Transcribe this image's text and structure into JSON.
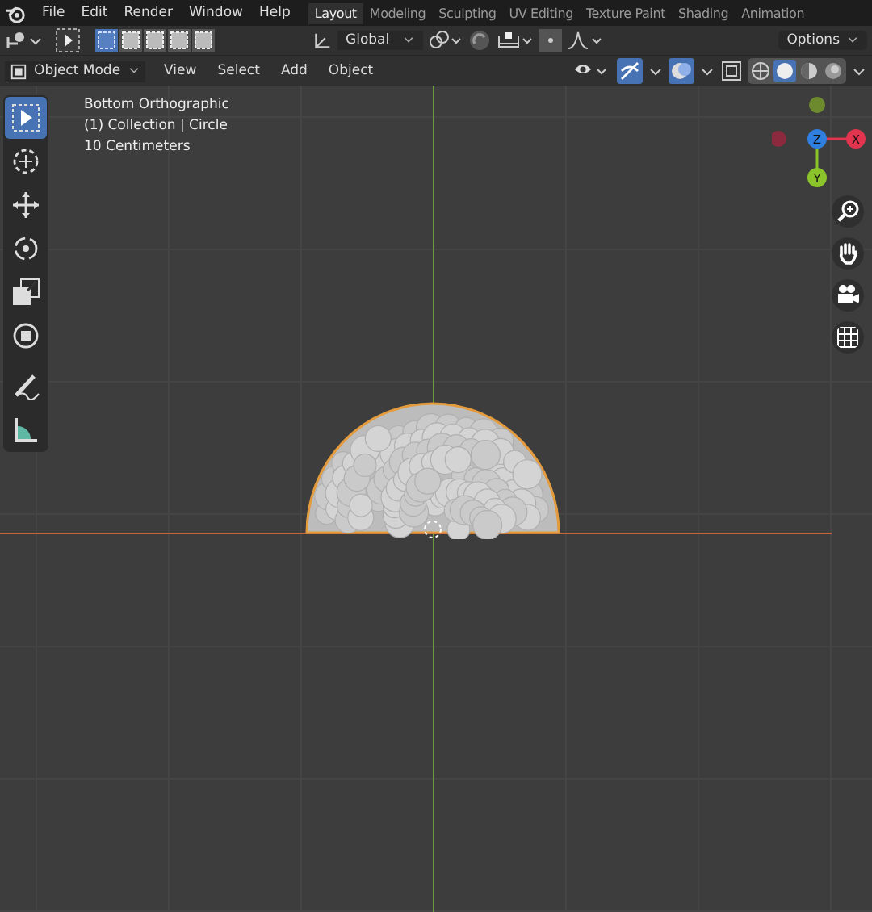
{
  "menu": [
    "File",
    "Edit",
    "Render",
    "Window",
    "Help"
  ],
  "workspaces": [
    {
      "label": "Layout",
      "selected": true
    },
    {
      "label": "Modeling",
      "selected": false
    },
    {
      "label": "Sculpting",
      "selected": false
    },
    {
      "label": "UV Editing",
      "selected": false
    },
    {
      "label": "Texture Paint",
      "selected": false
    },
    {
      "label": "Shading",
      "selected": false
    },
    {
      "label": "Animation",
      "selected": false
    }
  ],
  "tool_header": {
    "select_modes": [
      {
        "selected": true
      },
      {
        "selected": false
      },
      {
        "selected": false
      },
      {
        "selected": false
      },
      {
        "selected": false
      }
    ],
    "orientation": "Global",
    "options": "Options"
  },
  "viewport_header": {
    "mode": "Object Mode",
    "menus": [
      "View",
      "Select",
      "Add",
      "Object"
    ],
    "shading": [
      {
        "kind": "wireframe",
        "selected": false
      },
      {
        "kind": "solid",
        "selected": true
      },
      {
        "kind": "material",
        "selected": false
      },
      {
        "kind": "rendered",
        "selected": false
      }
    ]
  },
  "overlay_text": [
    "Bottom Orthographic",
    "(1) Collection | Circle",
    "10 Centimeters"
  ],
  "gizmo": {
    "axes": [
      {
        "label": "Z",
        "color": "#2f7fe0"
      },
      {
        "label": "X",
        "color": "#e0344f"
      },
      {
        "label": "Y",
        "color": "#8bc42a"
      }
    ]
  },
  "tools": [
    {
      "kind": "select",
      "selected": true
    },
    {
      "kind": "cursor",
      "selected": false
    },
    {
      "kind": "move",
      "selected": false
    },
    {
      "kind": "rotate",
      "selected": false
    },
    {
      "kind": "scale",
      "selected": false
    },
    {
      "kind": "transform",
      "selected": false
    },
    {
      "kind": "annotate",
      "selected": false
    },
    {
      "kind": "measure",
      "selected": false
    }
  ]
}
